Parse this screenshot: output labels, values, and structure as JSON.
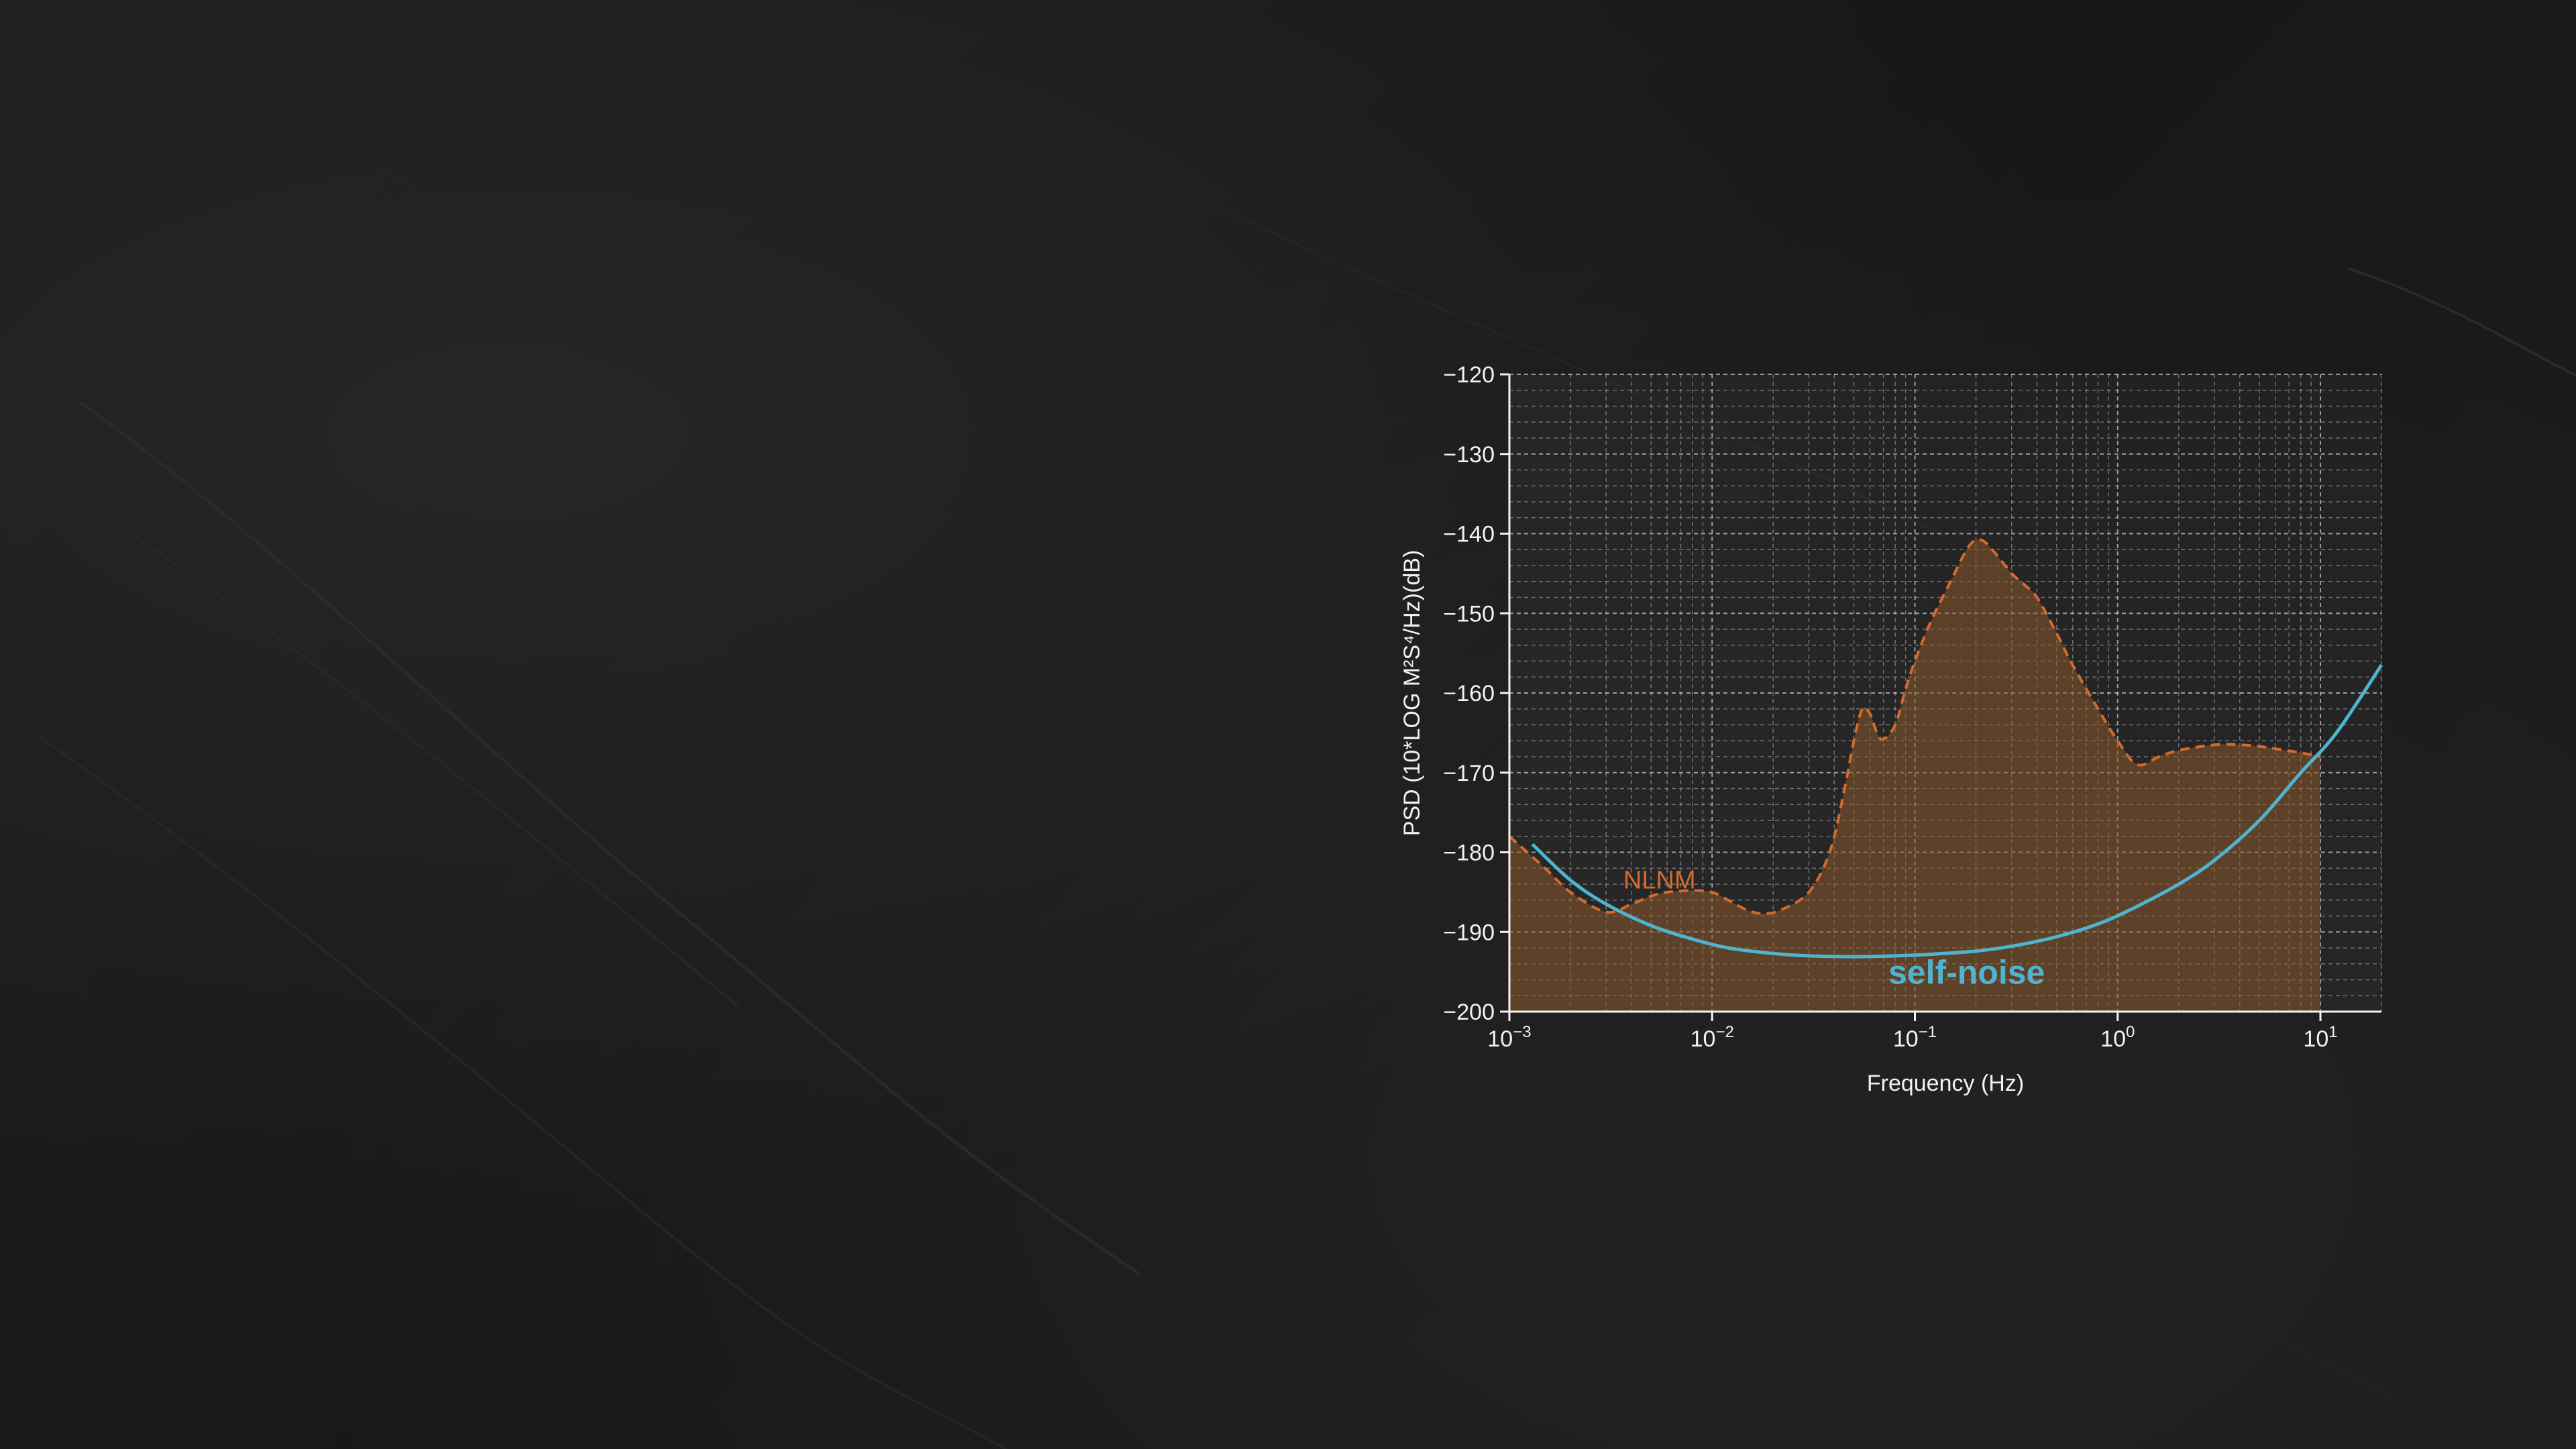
{
  "colors": {
    "background": "#1b1b1b",
    "nlnm": "#d46a2e",
    "nlnm_fill": "#8a5a2c",
    "self_noise": "#4fb4d0",
    "grid": "#ffffff",
    "text": "#f2f2f2"
  },
  "chart_data": {
    "type": "line",
    "xlabel": "Frequency (Hz)",
    "ylabel": "PSD (10*LOG M²S⁴/Hz)(dB)",
    "x_scale": "log",
    "xlim": [
      0.001,
      20
    ],
    "ylim": [
      -200,
      -120
    ],
    "x_ticks": [
      0.001,
      0.01,
      0.1,
      1,
      10
    ],
    "x_tick_labels": [
      {
        "base": "10",
        "exp": "−3"
      },
      {
        "base": "10",
        "exp": "−2"
      },
      {
        "base": "10",
        "exp": "−1"
      },
      {
        "base": "10",
        "exp": "0"
      },
      {
        "base": "10",
        "exp": "1"
      }
    ],
    "y_ticks": [
      -120,
      -130,
      -140,
      -150,
      -160,
      -170,
      -180,
      -190,
      -200
    ],
    "y_tick_labels": [
      "−120",
      "−130",
      "−140",
      "−150",
      "−160",
      "−170",
      "−180",
      "−190",
      "−200"
    ],
    "grid": true,
    "series": [
      {
        "name": "NLNM",
        "style": "dashed",
        "filled": true,
        "x": [
          0.001,
          0.0015,
          0.002,
          0.003,
          0.004,
          0.005,
          0.006,
          0.008,
          0.01,
          0.012,
          0.015,
          0.018,
          0.022,
          0.03,
          0.038,
          0.045,
          0.05,
          0.055,
          0.06,
          0.065,
          0.07,
          0.08,
          0.09,
          0.1,
          0.12,
          0.15,
          0.18,
          0.2,
          0.22,
          0.25,
          0.3,
          0.35,
          0.4,
          0.5,
          0.6,
          0.8,
          1.0,
          1.25,
          1.6,
          2.0,
          3.0,
          4.0,
          5.0,
          6.0,
          8.0,
          10.0
        ],
        "y": [
          -178,
          -182,
          -185,
          -187.5,
          -186.5,
          -185.5,
          -185,
          -184.8,
          -185,
          -186,
          -187.3,
          -187.7,
          -187.2,
          -185,
          -180,
          -172,
          -166,
          -162,
          -162.6,
          -165,
          -165.8,
          -164,
          -159.5,
          -156,
          -151,
          -146,
          -142,
          -140.8,
          -141,
          -142.5,
          -145,
          -146.5,
          -148,
          -152.5,
          -156.5,
          -162,
          -166,
          -169,
          -168,
          -167.2,
          -166.5,
          -166.5,
          -166.7,
          -167,
          -167.5,
          -168
        ]
      },
      {
        "name": "self-noise",
        "style": "solid",
        "filled": false,
        "x": [
          0.0013,
          0.002,
          0.003,
          0.005,
          0.008,
          0.012,
          0.02,
          0.03,
          0.05,
          0.08,
          0.12,
          0.2,
          0.3,
          0.5,
          0.8,
          1.2,
          2.0,
          3.0,
          5.0,
          8.0,
          12.0,
          20.0
        ],
        "y": [
          -179,
          -183.5,
          -186.5,
          -189.2,
          -190.9,
          -192,
          -192.7,
          -193,
          -193.1,
          -193,
          -192.8,
          -192.4,
          -191.8,
          -190.6,
          -189,
          -187,
          -184,
          -181,
          -176,
          -170,
          -165,
          -156.5
        ]
      }
    ],
    "annotations": [
      {
        "text": "NLNM",
        "x": 0.0055,
        "y": -182,
        "color": "#d46a2e"
      },
      {
        "text": "self-noise",
        "x": 0.18,
        "y": -196.5,
        "color": "#4fb4d0"
      }
    ]
  }
}
